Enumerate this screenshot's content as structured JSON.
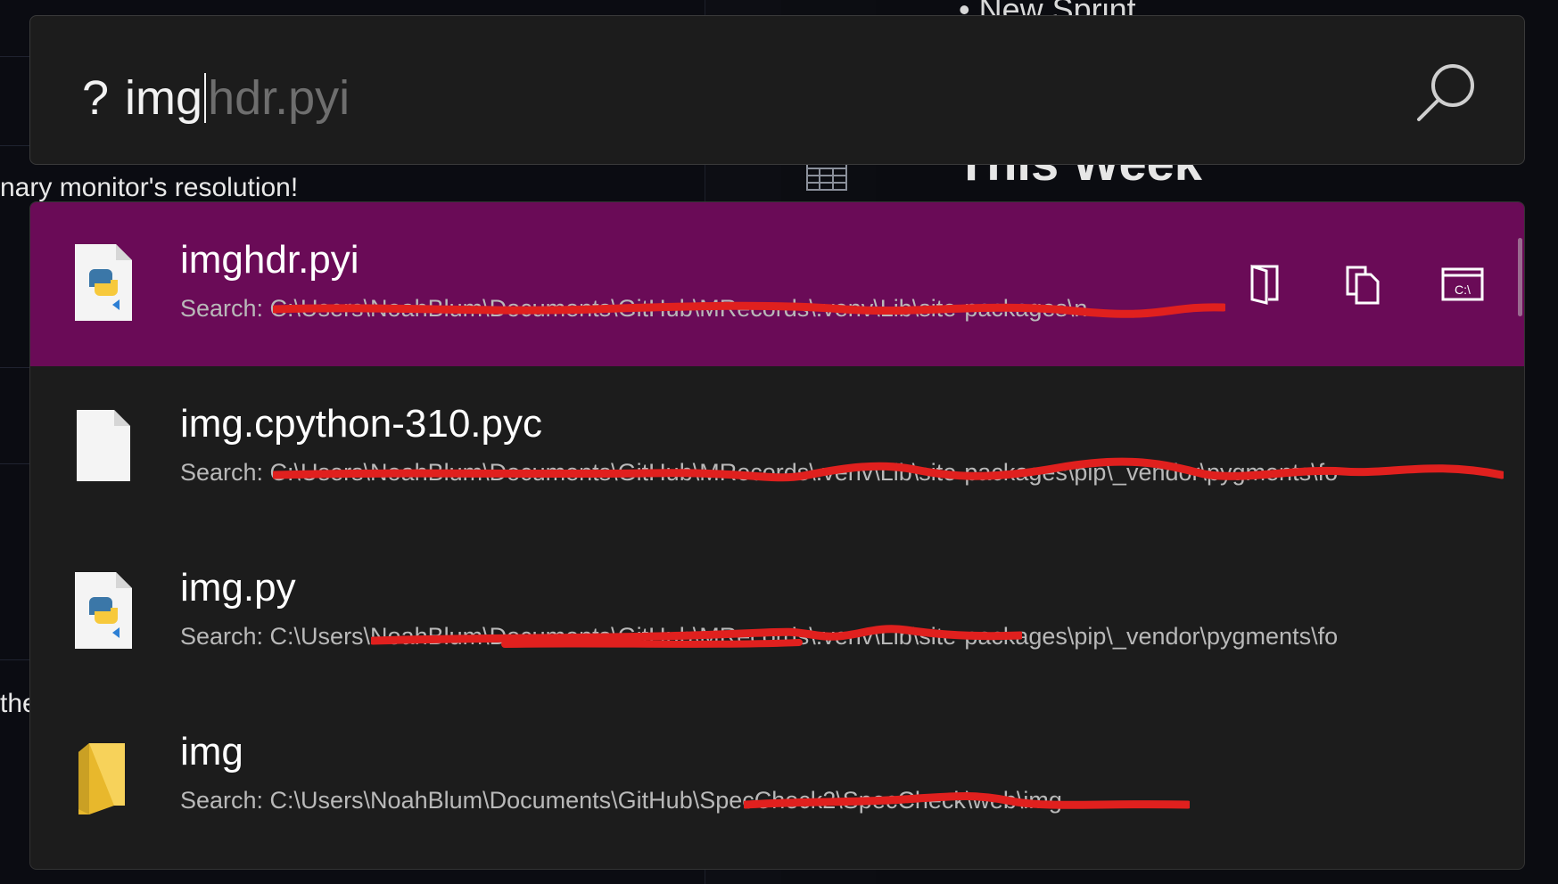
{
  "background": {
    "left_text_1": "nary monitor's resolution!",
    "left_text_2": "the",
    "right_bullet": "New Sprint",
    "right_heading": "This Week"
  },
  "search": {
    "prefix": "?",
    "typed": "img",
    "suggestion": "hdr.pyi",
    "search_icon": "search-icon"
  },
  "results": [
    {
      "title": "imghdr.pyi",
      "subtitle": "Search: C:\\Users\\NoahBlum\\Documents\\GitHub\\MRecords\\.venv\\Lib\\site-packages\\n",
      "icon": "python-file-icon",
      "selected": true,
      "actions": [
        "open-containing-folder-icon",
        "copy-path-icon",
        "open-in-console-icon"
      ],
      "console_label": "C:\\"
    },
    {
      "title": "img.cpython-310.pyc",
      "subtitle": "Search: C:\\Users\\NoahBlum\\Documents\\GitHub\\MRecords\\.venv\\Lib\\site-packages\\pip\\_vendor\\pygments\\fo",
      "icon": "blank-file-icon",
      "selected": false
    },
    {
      "title": "img.py",
      "subtitle": "Search: C:\\Users\\NoahBlum\\Documents\\GitHub\\MRecords\\.venv\\Lib\\site-packages\\pip\\_vendor\\pygments\\fo",
      "icon": "python-file-icon",
      "selected": false
    },
    {
      "title": "img",
      "subtitle": "Search: C:\\Users\\NoahBlum\\Documents\\GitHub\\SpecCheck2\\SpecCheck\\web\\img",
      "icon": "folder-icon",
      "selected": false
    }
  ],
  "colors": {
    "selected_row": "#6a0b57",
    "panel": "#1c1c1c",
    "redaction": "#e0201e"
  }
}
